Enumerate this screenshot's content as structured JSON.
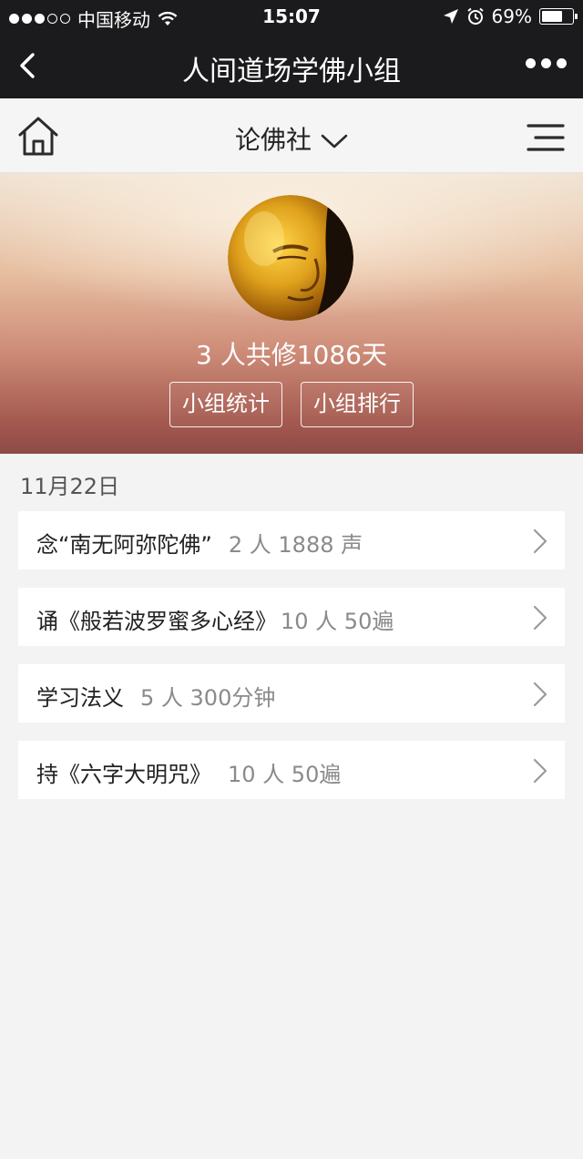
{
  "status": {
    "carrier": "中国移动",
    "time": "15:07",
    "battery": "69%",
    "battery_level": 0.69,
    "signal_bars_filled": 3,
    "signal_bars_total": 5
  },
  "nav": {
    "title": "人间道场学佛小组"
  },
  "sub_header": {
    "group_name": "论佛社"
  },
  "hero": {
    "stats_prefix": "3 人共修 ",
    "stats_days": "1086",
    "stats_suffix": " 天",
    "btn_stats": "小组统计",
    "btn_rank": "小组排行"
  },
  "date": "11月22日",
  "activities": [
    {
      "name": "念“南无阿弥陀佛”",
      "meta": "2 人 1888 声"
    },
    {
      "name": "诵《般若波罗蜜多心经》",
      "meta": "10 人 50遍"
    },
    {
      "name": "学习法义",
      "meta": "5 人 300分钟"
    },
    {
      "name": "持《六字大明咒》",
      "meta": "10 人 50遍"
    }
  ],
  "colors": {
    "nav_bg": "#1b1b1d",
    "page_bg": "#f4f3f4",
    "meta_text": "#8a8a8a"
  }
}
